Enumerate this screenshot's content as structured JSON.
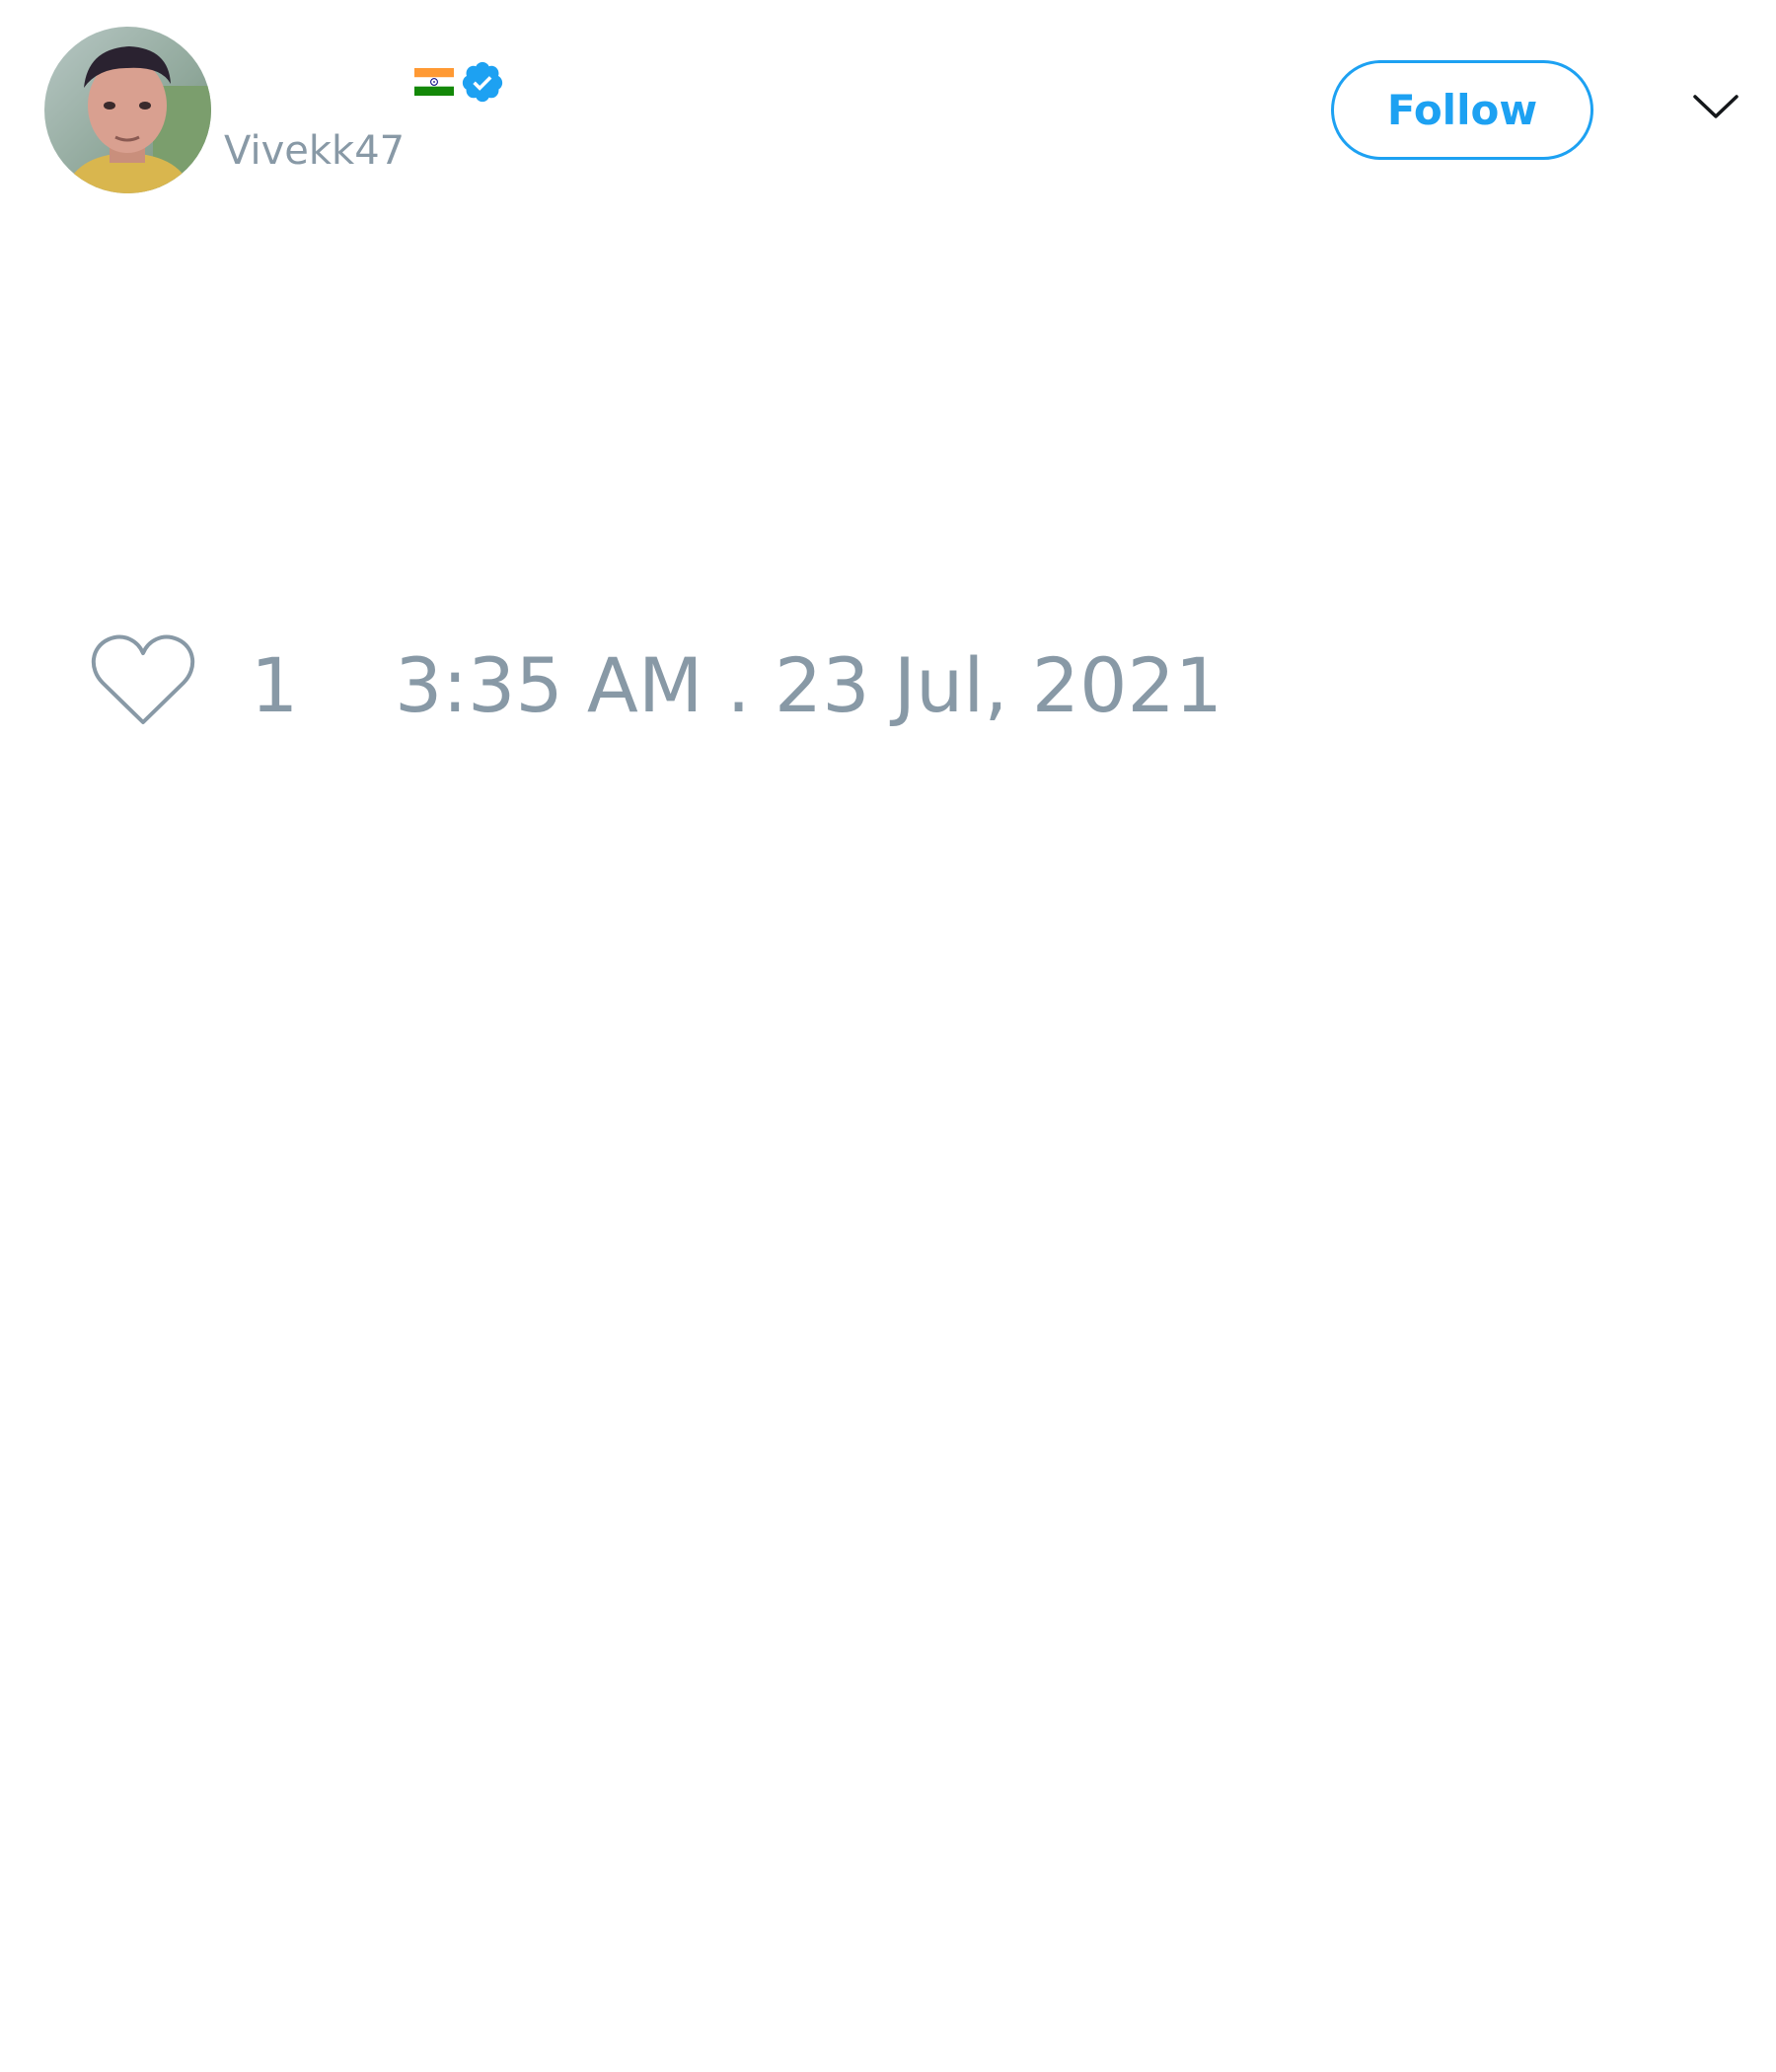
{
  "tweet": {
    "author": {
      "name_emoji": "🇮🇳",
      "handle": "Vivekk47",
      "verified": true,
      "avatar_icon": "profile-photo-icon",
      "flag_icon": "india-flag-icon",
      "verified_icon": "verified-badge-icon"
    },
    "follow_label": "Follow",
    "menu_icon": "chevron-down-icon",
    "like_icon": "heart-icon",
    "like_count": "1",
    "timestamp": "3:35 AM . 23 Jul, 2021"
  },
  "colors": {
    "accent": "#1da1f2",
    "muted_text": "#8899a6",
    "background": "#ffffff"
  }
}
